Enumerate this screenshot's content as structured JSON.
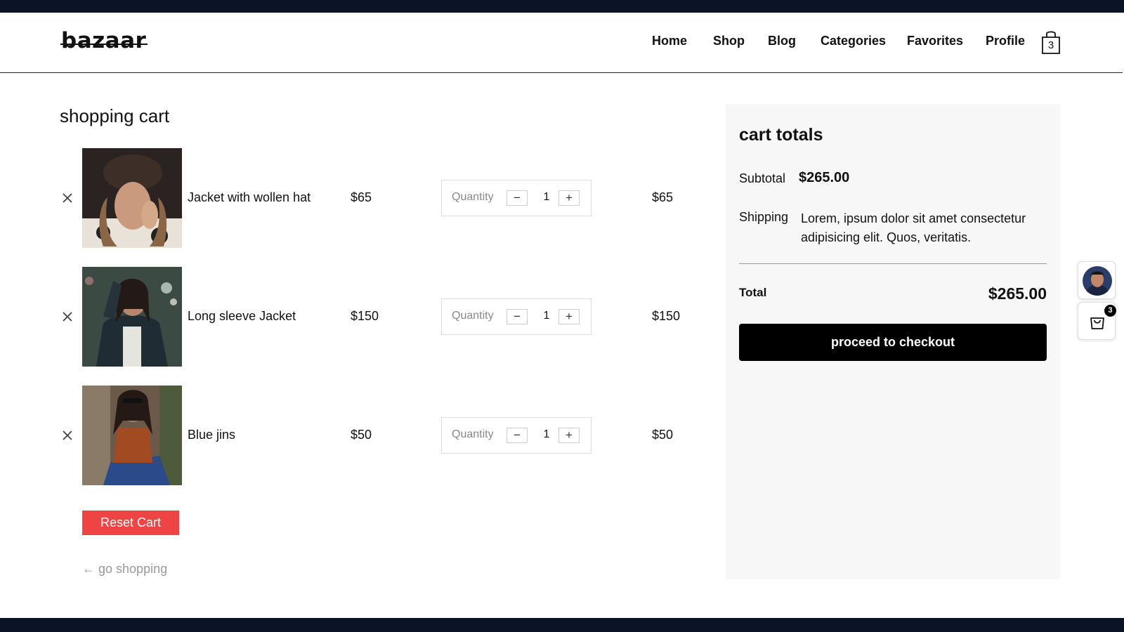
{
  "header": {
    "logo": "bazaar",
    "nav": [
      "Home",
      "Shop",
      "Blog",
      "Categories",
      "Favorites",
      "Profile"
    ],
    "cart_count": "3"
  },
  "cart": {
    "title": "shopping cart",
    "quantity_label": "Quantity",
    "items": [
      {
        "name": "Jacket with wollen hat",
        "price": "$65",
        "quantity": "1",
        "total": "$65"
      },
      {
        "name": "Long sleeve Jacket",
        "price": "$150",
        "quantity": "1",
        "total": "$150"
      },
      {
        "name": "Blue jins",
        "price": "$50",
        "quantity": "1",
        "total": "$50"
      }
    ],
    "reset_label": "Reset Cart",
    "go_shopping_label": "go shopping"
  },
  "totals": {
    "title": "cart totals",
    "subtotal_label": "Subtotal",
    "subtotal_value": "$265.00",
    "shipping_label": "Shipping",
    "shipping_text": "Lorem, ipsum dolor sit amet consectetur adipisicing elit. Quos, veritatis.",
    "total_label": "Total",
    "total_value": "$265.00",
    "checkout_label": "proceed to checkout"
  },
  "floating": {
    "cart_badge": "3"
  },
  "colors": {
    "top_bar": "#0b1426",
    "reset_button": "#ef4444",
    "checkout_button": "#000000",
    "totals_panel": "#f7f7f7"
  }
}
